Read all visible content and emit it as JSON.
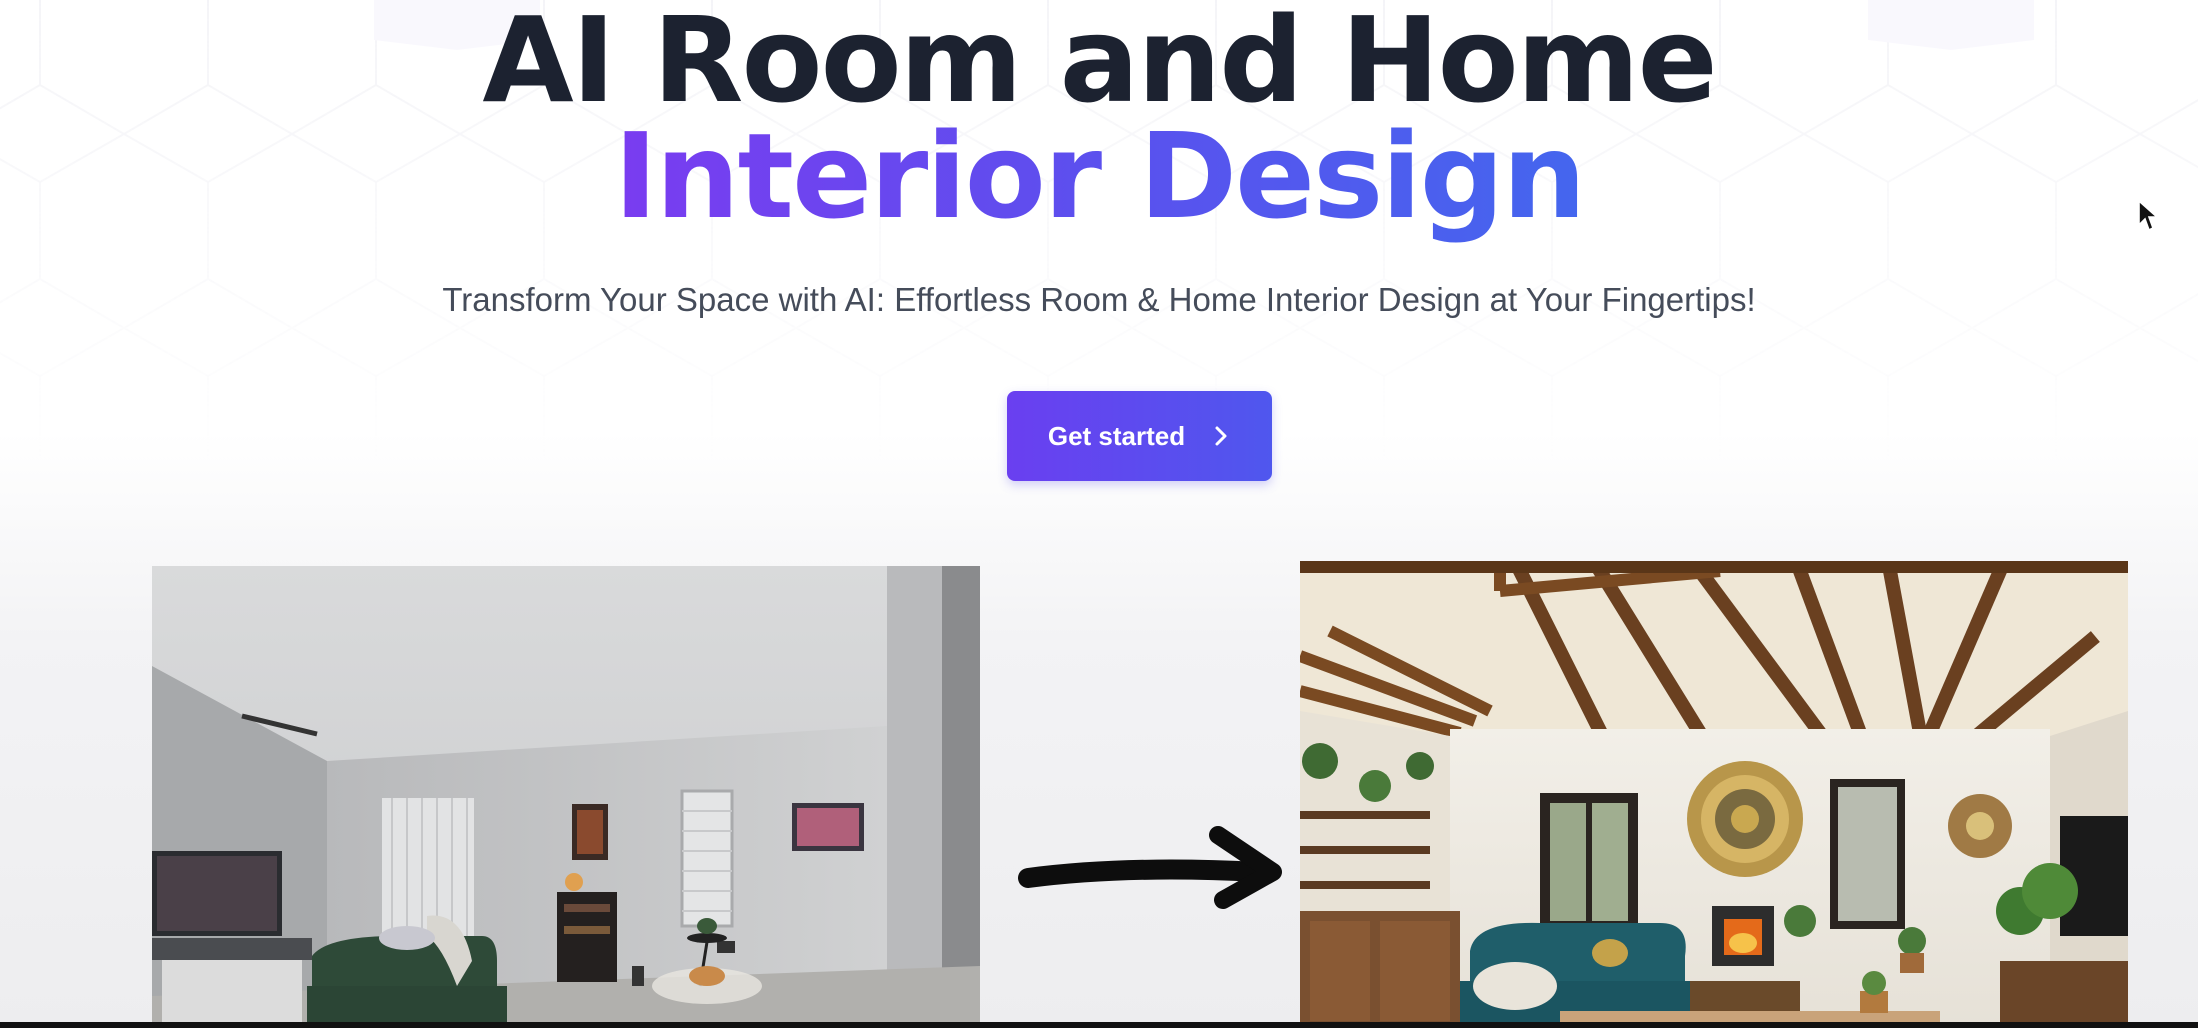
{
  "hero": {
    "title_line_1": "AI Room and Home",
    "title_line_2": "Interior Design",
    "subtitle": "Transform Your Space with AI: Effortless Room & Home Interior Design at Your Fingertips!",
    "cta_label": "Get started",
    "cta_icon": "chevron-right-icon"
  },
  "images": {
    "before_photo": "plain-living-room-photo",
    "after_photo": "redesigned-living-room-photo",
    "transition_icon": "arrow-right-icon"
  },
  "colors": {
    "title_dark": "#1c2230",
    "gradient_start": "#7a3cf0",
    "gradient_end": "#4466ee",
    "subtitle": "#454c5a",
    "button_start": "#6a3ff0",
    "button_end": "#4f57ee"
  }
}
